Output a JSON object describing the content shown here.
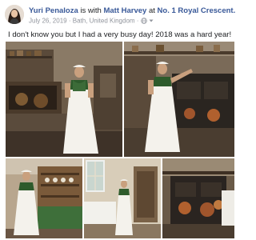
{
  "post": {
    "author": "Yuri Penaloza",
    "is_with_text": "is with",
    "tagged_person": "Matt Harvey",
    "at_text": "at",
    "place": "No. 1 Royal Crescent.",
    "date": "July 26, 2019",
    "separator": "·",
    "location": "Bath, United Kingdom",
    "separator2": "·",
    "privacy_icon": "globe-icon",
    "menu_icon": "caret-down-icon",
    "text": "I don't know you but I had a very busy day! 2018 was a hard year!"
  },
  "photos": [
    {
      "subject": "kitchen-hearth-woman-white-apron"
    },
    {
      "subject": "kitchen-range-woman-arm-outstretched"
    },
    {
      "subject": "kitchen-dresser-woman-standing"
    },
    {
      "subject": "scullery-window-woman"
    },
    {
      "subject": "kitchen-range-copper-pots"
    }
  ],
  "colors": {
    "link": "#385898",
    "text": "#1c1e21",
    "meta": "#90949c"
  }
}
